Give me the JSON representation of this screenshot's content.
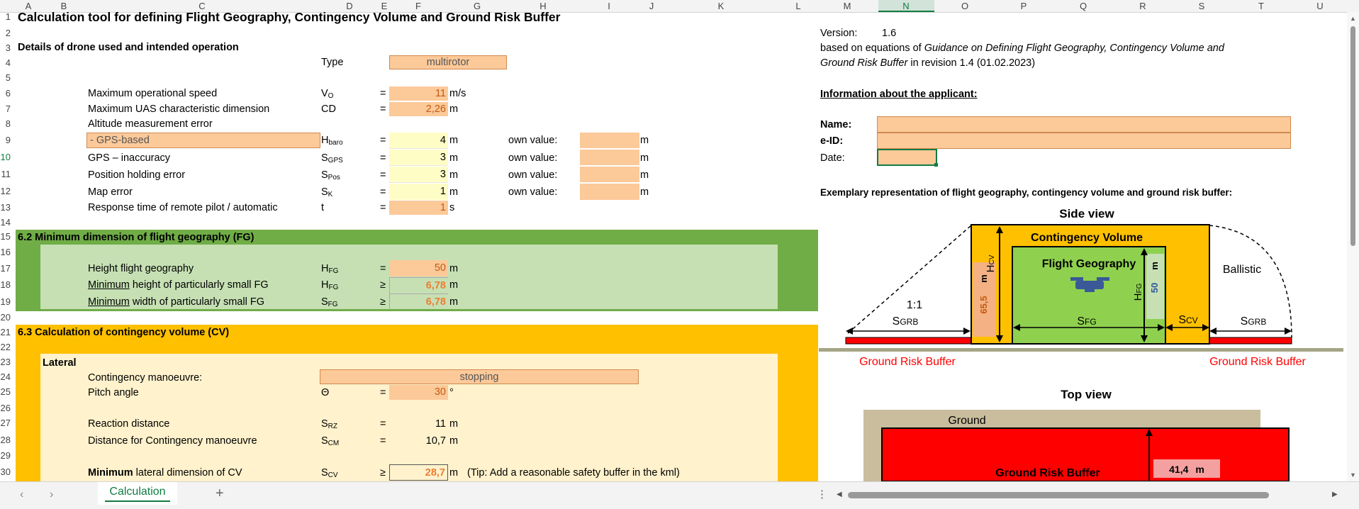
{
  "columns": [
    "A",
    "B",
    "C",
    "D",
    "E",
    "F",
    "G",
    "H",
    "I",
    "J",
    "K",
    "L",
    "M",
    "N",
    "O",
    "P",
    "Q",
    "R",
    "S",
    "T",
    "U"
  ],
  "selected_column": "N",
  "selected_row": "10",
  "rows": [
    "1",
    "2",
    "3",
    "4",
    "5",
    "6",
    "7",
    "8",
    "9",
    "10",
    "11",
    "12",
    "13",
    "14",
    "15",
    "16",
    "17",
    "18",
    "19",
    "20",
    "21",
    "22",
    "23",
    "24",
    "25",
    "26",
    "27",
    "28",
    "29",
    "30"
  ],
  "title": "Calculation tool for defining Flight Geography, Contingency Volume and Ground Risk Buffer",
  "section_drone": "Details of drone used and intended operation",
  "type_label": "Type",
  "type_value": "multirotor",
  "params": [
    {
      "label": "Maximum operational speed",
      "sym": "V",
      "sub": "O",
      "op": "=",
      "value": "11",
      "unit": "m/s"
    },
    {
      "label": "Maximum UAS characteristic dimension",
      "sym": "CD",
      "sub": "",
      "op": "=",
      "value": "2,26",
      "unit": "m"
    },
    {
      "label": "Altitude measurement error",
      "sym": "",
      "sub": "",
      "op": "",
      "value": "",
      "unit": ""
    },
    {
      "label": "- GPS-based",
      "sym": "H",
      "sub": "baro",
      "op": "=",
      "value": "4",
      "unit": "m",
      "own": "own value:",
      "own_unit": "m"
    },
    {
      "label": "GPS – inaccuracy",
      "sym": "S",
      "sub": "GPS",
      "op": "=",
      "value": "3",
      "unit": "m",
      "own": "own value:",
      "own_unit": "m"
    },
    {
      "label": "Position holding error",
      "sym": "S",
      "sub": "Pos",
      "op": "=",
      "value": "3",
      "unit": "m",
      "own": "own value:",
      "own_unit": "m"
    },
    {
      "label": "Map error",
      "sym": "S",
      "sub": "K",
      "op": "=",
      "value": "1",
      "unit": "m",
      "own": "own value:",
      "own_unit": "m"
    },
    {
      "label": "Response time of remote pilot / automatic",
      "sym": "t",
      "sub": "",
      "op": "=",
      "value": "1",
      "unit": "s"
    }
  ],
  "section_fg": "6.2 Minimum dimension of flight geography (FG)",
  "fg_rows": [
    {
      "pre": "",
      "und": "",
      "label": "Height flight geography",
      "sym": "H",
      "sub": "FG",
      "op": "=",
      "value": "50",
      "unit": "m"
    },
    {
      "pre": "",
      "und": "Minimum",
      "label": " height of particularly small FG",
      "sym": "H",
      "sub": "FG",
      "op": "≥",
      "value": "6,78",
      "unit": "m"
    },
    {
      "pre": "",
      "und": "Minimum",
      "label": " width of particularly small FG",
      "sym": "S",
      "sub": "FG",
      "op": "≥",
      "value": "6,78",
      "unit": "m"
    }
  ],
  "section_cv": "6.3 Calculation of contingency volume (CV)",
  "lateral": "Lateral",
  "cm_label": "Contingency manoeuvre:",
  "cm_value": "stopping",
  "pitch_label": "Pitch angle",
  "pitch_sym": "Θ",
  "pitch_value": "30",
  "pitch_unit": "°",
  "reaction_label": "Reaction distance",
  "reaction_sym": "S",
  "reaction_sub": "RZ",
  "reaction_value": "11",
  "reaction_unit": "m",
  "cmdist_label": "Distance for Contingency manoeuvre",
  "cmdist_sym": "S",
  "cmdist_sub": "CM",
  "cmdist_value": "10,7",
  "cmdist_unit": "m",
  "minlat_bold": "Minimum",
  "minlat_label": " lateral dimension of CV",
  "minlat_sym": "S",
  "minlat_sub": "CV",
  "minlat_op": "≥",
  "minlat_value": "28,7",
  "minlat_unit": "m",
  "minlat_tip": "(Tip: Add a reasonable safety buffer in the kml)",
  "right": {
    "version_label": "Version:",
    "version_value": "1.6",
    "based_prefix": "based on equations of ",
    "based_italic": "Guidance on Defining Flight Geography, Contingency Volume and",
    "based_italic2": "Ground Risk Buffer",
    "based_suffix": " in revision 1.4 (01.02.2023)",
    "applicant_heading": "Information about the applicant:",
    "name_label": "Name:",
    "eid_label": "e-ID:",
    "date_label": "Date:",
    "exemplary": "Exemplary representation of flight geography, contingency volume and ground risk buffer:"
  },
  "diagram": {
    "side_view": "Side view",
    "contingency_volume": "Contingency Volume",
    "flight_geography": "Flight Geography",
    "ballistic": "Ballistic",
    "ratio": "1:1",
    "s_grb": "S",
    "s_grb_sub": "GRB",
    "s_fg": "S",
    "s_fg_sub": "FG",
    "s_cv": "S",
    "s_cv_sub": "CV",
    "h_cv": "H",
    "h_cv_sub": "CV",
    "h_fg": "H",
    "h_fg_sub": "FG",
    "h_cv_value": "65,5",
    "h_fg_value": "50",
    "unit_m": "m",
    "ground_risk_buffer_left": "Ground Risk Buffer",
    "ground_risk_buffer_right": "Ground Risk Buffer",
    "top_view": "Top view",
    "ground": "Ground",
    "grb_top_label": "Ground Risk Buffer",
    "grb_top_value": "41,4",
    "grb_top_unit": "m"
  },
  "sheet_tab": "Calculation",
  "colors": {
    "orange": "#fcc999",
    "yellow": "#fffdc6",
    "green_dark": "#70ad47",
    "green_light": "#c6e0b4",
    "amber": "#ffc000",
    "cream": "#fff2cc",
    "red": "#ff0000",
    "accent": "#107c41"
  }
}
